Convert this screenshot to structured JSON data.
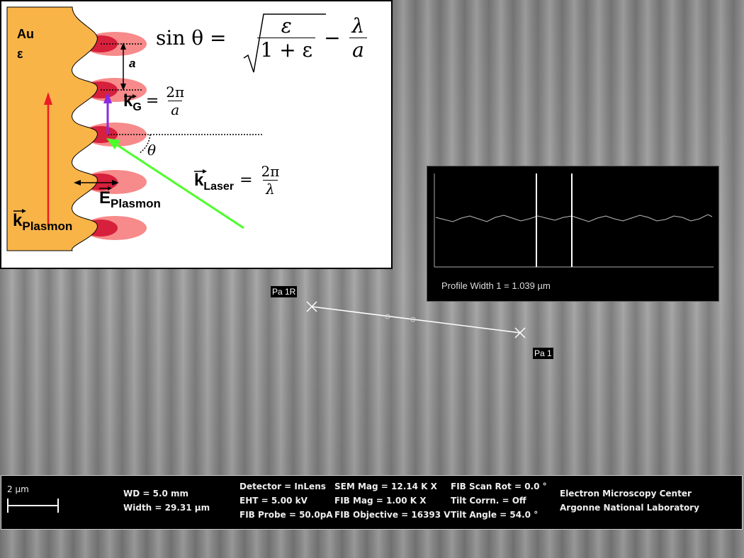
{
  "diagram": {
    "material": "Au",
    "epsilon": "ε",
    "period_label": "a",
    "theta_label": "θ",
    "equation_main": {
      "lhs": "sin θ =",
      "num": "ε",
      "den": "1 + ε",
      "minus": "−",
      "num2": "λ",
      "den2": "a"
    },
    "kG": {
      "symbol": "k",
      "sub": "G",
      "eq": "=",
      "num": "2π",
      "den": "a"
    },
    "kLaser": {
      "symbol": "k",
      "sub": "Laser",
      "eq": "=",
      "num": "2π",
      "den": "λ"
    },
    "EPlasmon": {
      "symbol": "E",
      "sub": "Plasmon"
    },
    "kPlasmon": {
      "symbol": "k",
      "sub": "Plasmon"
    },
    "colors": {
      "gold": "#f9b448",
      "red_arrow": "#ee1c24",
      "violet": "#8a2be2",
      "green": "#4cff2a",
      "lobe_outer": "#f78a8a",
      "lobe_inner": "#d6203c"
    }
  },
  "profile": {
    "text": "Profile Width 1 = 1.039 µm"
  },
  "markers": {
    "start": "Pa 1R",
    "end": "Pa 1"
  },
  "infobar": {
    "scale": "2 µm",
    "wd": "WD =  5.0 mm",
    "width": "Width = 29.31 µm",
    "detector": "Detector = InLens",
    "eht": "EHT =  5.00 kV",
    "fib_probe": "FIB Probe = 50.0pA",
    "sem_mag": "SEM Mag =  12.14 K X",
    "fib_mag": "FIB Mag =   1.00 K X",
    "fib_obj": "FIB Objective = 16393 V",
    "scan_rot": "FIB Scan Rot =   0.0 °",
    "tilt_corr": "Tilt Corrn. = Off",
    "tilt_angle": "Tilt Angle =  54.0 °",
    "org1": "Electron Microscopy Center",
    "org2": "Argonne National Laboratory"
  }
}
